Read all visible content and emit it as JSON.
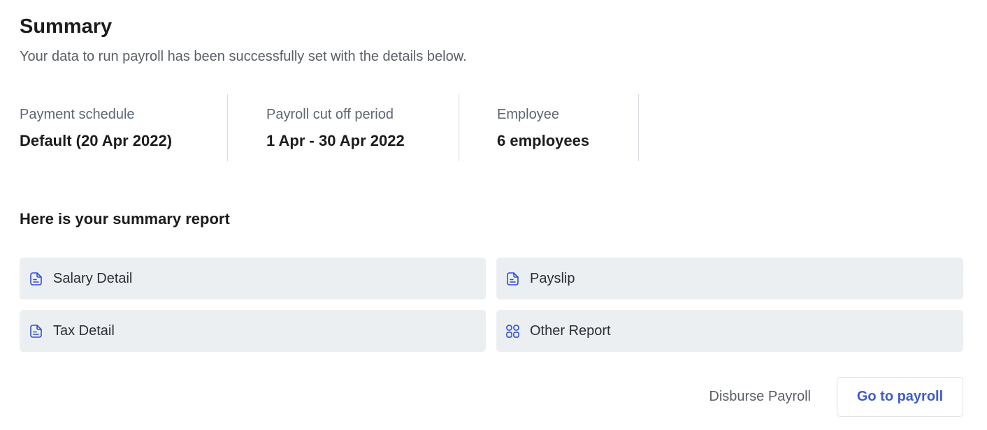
{
  "summary": {
    "title": "Summary",
    "subtitle": "Your data to run payroll has been successfully set with the details below."
  },
  "stats": [
    {
      "label": "Payment schedule",
      "value": "Default (20 Apr 2022)"
    },
    {
      "label": "Payroll cut off period",
      "value": "1 Apr - 30 Apr 2022"
    },
    {
      "label": "Employee",
      "value": "6 employees"
    }
  ],
  "report": {
    "heading": "Here is your summary report",
    "items": [
      {
        "label": "Salary Detail",
        "icon": "document-icon"
      },
      {
        "label": "Payslip",
        "icon": "document-icon"
      },
      {
        "label": "Tax Detail",
        "icon": "document-icon"
      },
      {
        "label": "Other Report",
        "icon": "grid-icon"
      }
    ]
  },
  "actions": {
    "disburse_label": "Disburse Payroll",
    "goto_label": "Go to payroll"
  },
  "colors": {
    "accent": "#3d5ccf",
    "card_background": "#eceff2",
    "icon": "#2f4fd0"
  }
}
